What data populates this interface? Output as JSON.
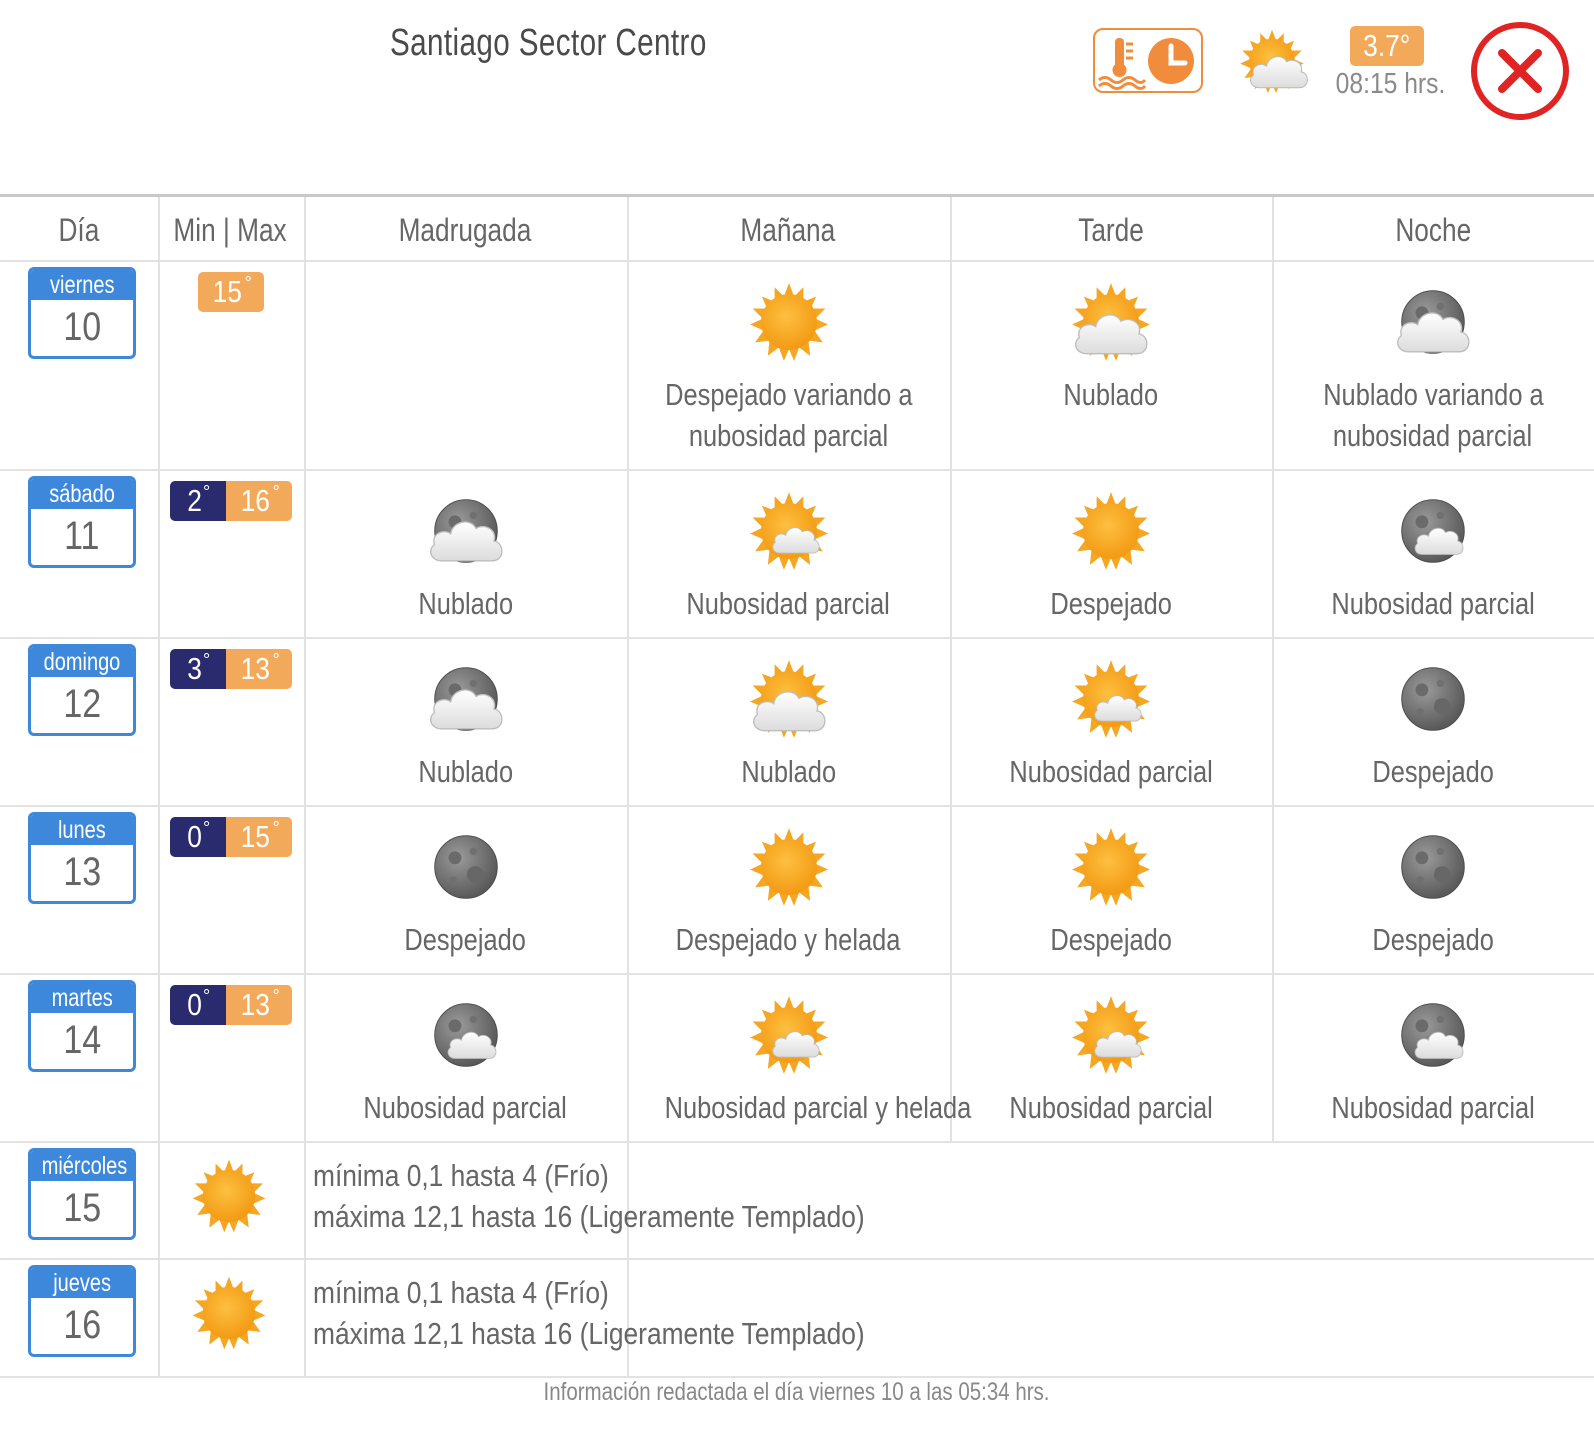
{
  "header": {
    "title": "Santiago Sector Centro",
    "current_temp": "3.7°",
    "current_time": "08:15 hrs.",
    "thermo_clock_icon": "thermometer-clock-icon",
    "current_weather_icon": "partly-cloudy-icon",
    "close_icon": "close-icon"
  },
  "columns": {
    "day": "Día",
    "minmax": "Min | Max",
    "madrugada": "Madrugada",
    "manana": "Mañana",
    "tarde": "Tarde",
    "noche": "Noche"
  },
  "days": [
    {
      "name": "viernes",
      "num": "10",
      "min": "",
      "max": "15",
      "periods": [
        {
          "icon": "",
          "text": ""
        },
        {
          "icon": "sun",
          "text": "Despejado variando a nubosidad parcial"
        },
        {
          "icon": "sun-cloud-big",
          "text": "Nublado"
        },
        {
          "icon": "moon-cloud-big",
          "text": "Nublado variando a nubosidad parcial"
        }
      ]
    },
    {
      "name": "sábado",
      "num": "11",
      "min": "2",
      "max": "16",
      "periods": [
        {
          "icon": "moon-cloud-big",
          "text": "Nublado"
        },
        {
          "icon": "sun-cloud",
          "text": "Nubosidad parcial"
        },
        {
          "icon": "sun",
          "text": "Despejado"
        },
        {
          "icon": "moon-cloud",
          "text": "Nubosidad parcial"
        }
      ]
    },
    {
      "name": "domingo",
      "num": "12",
      "min": "3",
      "max": "13",
      "periods": [
        {
          "icon": "moon-cloud-big",
          "text": "Nublado"
        },
        {
          "icon": "sun-cloud-big",
          "text": "Nublado"
        },
        {
          "icon": "sun-cloud",
          "text": "Nubosidad parcial"
        },
        {
          "icon": "moon",
          "text": "Despejado"
        }
      ]
    },
    {
      "name": "lunes",
      "num": "13",
      "min": "0",
      "max": "15",
      "periods": [
        {
          "icon": "moon",
          "text": "Despejado"
        },
        {
          "icon": "sun",
          "text": "Despejado y helada"
        },
        {
          "icon": "sun",
          "text": "Despejado"
        },
        {
          "icon": "moon",
          "text": "Despejado"
        }
      ]
    },
    {
      "name": "martes",
      "num": "14",
      "min": "0",
      "max": "13",
      "periods": [
        {
          "icon": "moon-cloud",
          "text": "Nubosidad parcial"
        },
        {
          "icon": "sun-cloud",
          "text": "Nubosidad parcial y helada"
        },
        {
          "icon": "sun-cloud",
          "text": "Nubosidad parcial"
        },
        {
          "icon": "moon-cloud",
          "text": "Nubosidad parcial"
        }
      ]
    }
  ],
  "extended": [
    {
      "name": "miércoles",
      "num": "15",
      "icon": "sun",
      "line1": "mínima 0,1 hasta 4 (Frío)",
      "line2": "máxima 12,1 hasta 16 (Ligeramente Templado)"
    },
    {
      "name": "jueves",
      "num": "16",
      "icon": "sun",
      "line1": "mínima 0,1 hasta 4 (Frío)",
      "line2": "máxima 12,1 hasta 16 (Ligeramente Templado)"
    }
  ],
  "footer": "Información redactada el día viernes 10 a las 05:34 hrs.",
  "colors": {
    "accent_blue": "#3e88dc",
    "min_temp_bg": "#2a2a6e",
    "max_temp_bg": "#f3a95a",
    "close_red": "#e02424",
    "orange": "#f08c3c"
  }
}
